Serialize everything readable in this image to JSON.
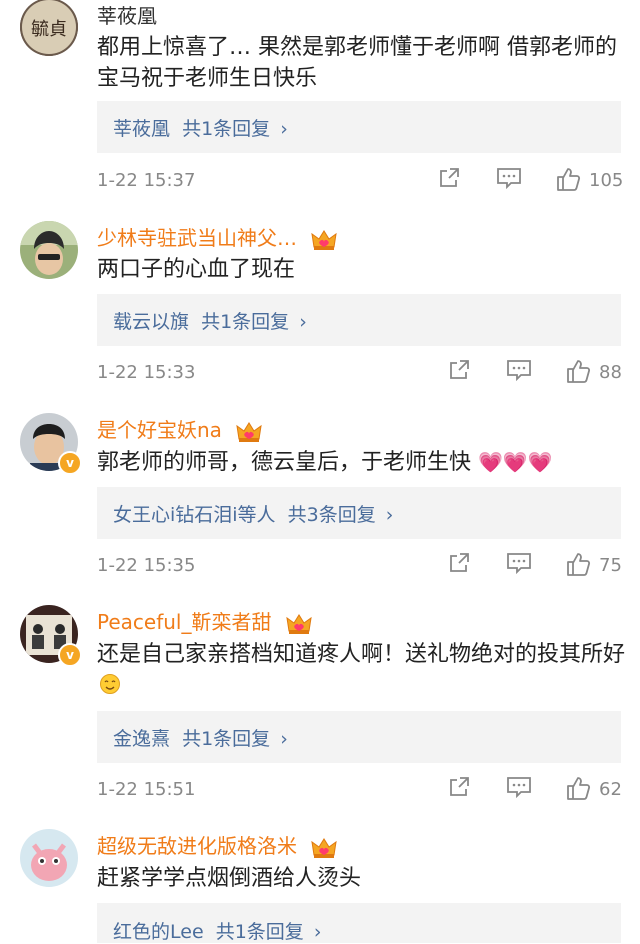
{
  "comments": [
    {
      "username": "莘莜凰",
      "text": "都用上惊喜了… 果然是郭老师懂于老师啊 借郭老师的宝马祝于老师生日快乐",
      "reply_name": "莘莜凰",
      "reply_count": "共1条回复",
      "time": "1-22 15:37",
      "likes": "105"
    },
    {
      "username": "少林寺驻武当山神父…",
      "text": "两口子的心血了现在",
      "reply_name": "载云以旗",
      "reply_count": "共1条回复",
      "time": "1-22 15:33",
      "likes": "88"
    },
    {
      "username": "是个好宝妖na",
      "text": "郭老师的师哥，德云皇后，于老师生快",
      "reply_name": "女王心i钻石泪i等人",
      "reply_count": "共3条回复",
      "time": "1-22 15:35",
      "likes": "75"
    },
    {
      "username": "Peaceful_靳栾者甜",
      "text": "还是自己家亲搭档知道疼人啊！送礼物绝对的投其所好",
      "reply_name": "金逸熹",
      "reply_count": "共1条回复",
      "time": "1-22 15:51",
      "likes": "62"
    },
    {
      "username": "超级无敌进化版格洛米",
      "text": "赶紧学学点烟倒酒给人烫头",
      "reply_name": "红色的Lee",
      "reply_count": "共1条回复"
    }
  ],
  "icons": {
    "share": "share-icon",
    "comment": "comment-icon",
    "like": "thumbs-up-icon",
    "crown": "vip-crown-icon",
    "verified": "verified-badge-icon",
    "heart": "heart-emoji-icon",
    "emoji": "hug-emoji-icon",
    "chevron": "chevron-right-icon"
  },
  "colors": {
    "username_vip": "#f07c19",
    "reply_link": "#4a6c9b",
    "meta_gray": "#888888"
  },
  "avatar_text": {
    "c0": "毓貞"
  }
}
